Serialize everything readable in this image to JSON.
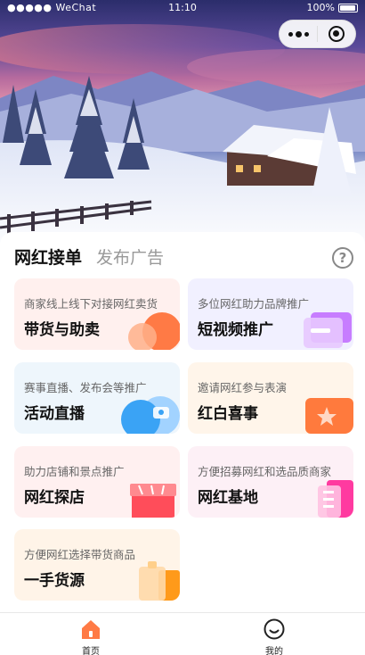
{
  "status_bar": {
    "carrier": "●●●●● WeChat",
    "time": "11:10",
    "battery": "100%"
  },
  "header": {
    "tabs": [
      {
        "label": "网红接单",
        "active": true
      },
      {
        "label": "发布广告",
        "active": false
      }
    ],
    "help_label": "?"
  },
  "cards": [
    {
      "subtitle": "商家线上线下对接网红卖货",
      "title": "带货与助卖",
      "bg": "#fff0ee",
      "accent": "#ff7a45",
      "icon": "coins-icon"
    },
    {
      "subtitle": "多位网红助力品牌推广",
      "title": "短视频推广",
      "bg": "#f1f0ff",
      "accent": "#c77dff",
      "icon": "video-icon"
    },
    {
      "subtitle": "赛事直播、发布会等推广",
      "title": "活动直播",
      "bg": "#eef6fc",
      "accent": "#3aa3f5",
      "icon": "camera-icon"
    },
    {
      "subtitle": "邀请网红参与表演",
      "title": "红白喜事",
      "bg": "#fff5ea",
      "accent": "#ff7a3d",
      "icon": "star-badge-icon"
    },
    {
      "subtitle": "助力店铺和景点推广",
      "title": "网红探店",
      "bg": "#fff0f0",
      "accent": "#ff4d5a",
      "icon": "shop-icon"
    },
    {
      "subtitle": "方便招募网红和选品质商家",
      "title": "网红基地",
      "bg": "#fdf0f6",
      "accent": "#ff3aa0",
      "icon": "building-icon"
    },
    {
      "subtitle": "方便网红选择带货商品",
      "title": "一手货源",
      "bg": "#fff4e8",
      "accent": "#ff9a1a",
      "icon": "goods-icon"
    }
  ],
  "bottom_nav": [
    {
      "label": "首页",
      "icon": "home-icon",
      "active": true
    },
    {
      "label": "我的",
      "icon": "smile-icon",
      "active": false
    }
  ],
  "colors": {
    "brand": "#ff7a45",
    "text_primary": "#111111",
    "text_secondary": "#666666"
  }
}
